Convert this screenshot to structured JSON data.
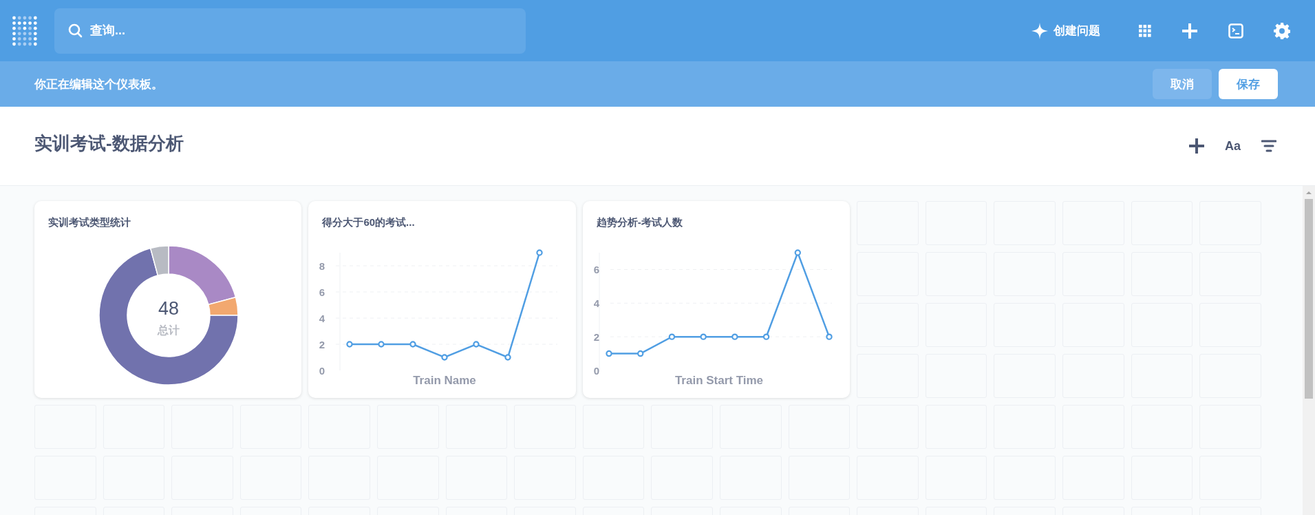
{
  "app_bar": {
    "search": {
      "placeholder": "查询..."
    },
    "create_question": "创建问题"
  },
  "edit_banner": {
    "message": "你正在编辑这个仪表板。",
    "buttons": [
      {
        "label": "取消",
        "kind": "secondary"
      },
      {
        "label": "保存",
        "kind": "primary"
      }
    ]
  },
  "dashboard": {
    "title": "实训考试-数据分析",
    "text_tool": "Aa"
  },
  "cards": [
    {
      "title": "实训考试类型统计",
      "total": "48",
      "total_label": "总计",
      "chart_data": {
        "type": "donut",
        "values": [
          20.8,
          4.2,
          70.8,
          4.2
        ],
        "colors": [
          "#a989c5",
          "#f2a86f",
          "#7172ad",
          "#b8bbc3"
        ]
      }
    },
    {
      "title": "得分大于60的考试...",
      "chart_data": {
        "type": "line",
        "xlabel": "Train Name",
        "ylim": [
          0,
          9
        ],
        "yticks": [
          0,
          2,
          4,
          6,
          8
        ],
        "grid": true,
        "marker": true,
        "values": [
          2,
          2,
          2,
          1,
          2,
          1,
          9
        ]
      }
    },
    {
      "title": "趋势分析-考试人数",
      "chart_data": {
        "type": "line",
        "xlabel": "Train Start Time",
        "ylim": [
          0,
          7
        ],
        "yticks": [
          0,
          2,
          4,
          6
        ],
        "grid": true,
        "marker": true,
        "values": [
          1,
          1,
          2,
          2,
          2,
          2,
          7,
          2
        ]
      }
    }
  ]
}
